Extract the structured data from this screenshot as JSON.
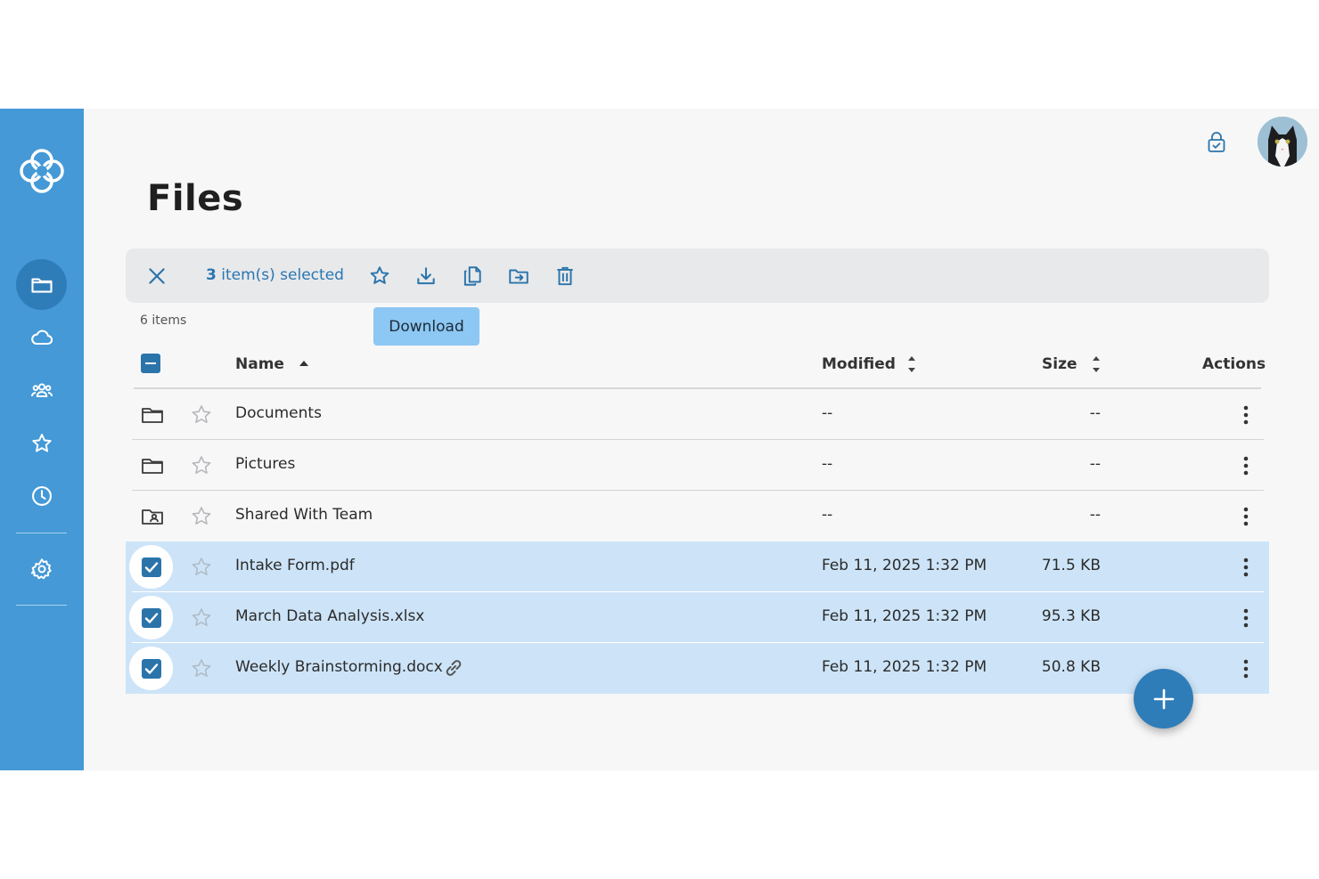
{
  "page": {
    "title": "Files"
  },
  "sidebar": {
    "items": [
      {
        "name": "files",
        "icon": "folder-icon"
      },
      {
        "name": "cloud",
        "icon": "cloud-icon"
      },
      {
        "name": "shared",
        "icon": "people-icon"
      },
      {
        "name": "favorites",
        "icon": "star-icon"
      },
      {
        "name": "recent",
        "icon": "clock-icon"
      },
      {
        "name": "settings",
        "icon": "gear-icon"
      }
    ]
  },
  "toolbar": {
    "selected_count": "3",
    "selected_label": "item(s) selected",
    "tooltip": "Download"
  },
  "list": {
    "items_count": "6 items",
    "columns": {
      "name": "Name",
      "modified": "Modified",
      "size": "Size",
      "actions": "Actions"
    },
    "rows": [
      {
        "name": "Documents",
        "modified": "--",
        "size": "--",
        "type": "folder",
        "selected": false
      },
      {
        "name": "Pictures",
        "modified": "--",
        "size": "--",
        "type": "folder",
        "selected": false
      },
      {
        "name": "Shared With Team",
        "modified": "--",
        "size": "--",
        "type": "shared-folder",
        "selected": false
      },
      {
        "name": "Intake Form.pdf",
        "modified": "Feb 11, 2025 1:32 PM",
        "size": "71.5 KB",
        "type": "file",
        "selected": true
      },
      {
        "name": "March Data Analysis.xlsx",
        "modified": "Feb 11, 2025 1:32 PM",
        "size": "95.3 KB",
        "type": "file",
        "selected": true
      },
      {
        "name": "Weekly Brainstorming.docx",
        "modified": "Feb 11, 2025 1:32 PM",
        "size": "50.8 KB",
        "type": "file",
        "selected": true,
        "shared_link": true
      }
    ]
  },
  "colors": {
    "sidebar": "#4499d6",
    "accent": "#2f7db8",
    "selected_row": "#cde4f8",
    "tooltip": "#8dc7f3"
  }
}
